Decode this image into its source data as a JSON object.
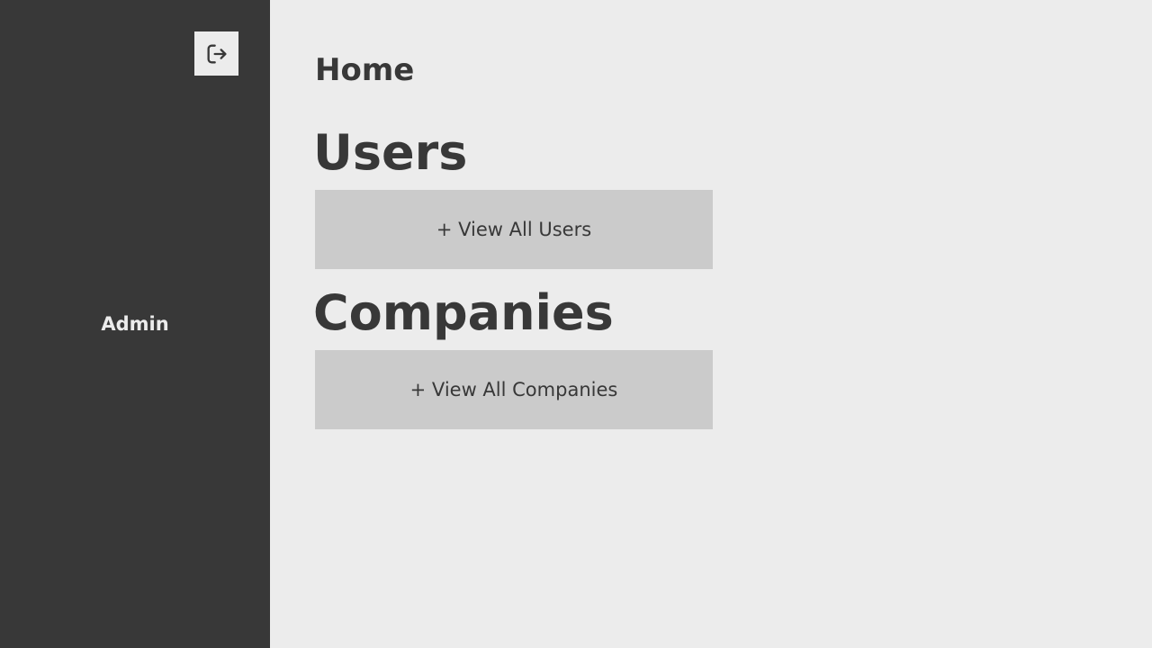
{
  "sidebar": {
    "username": "Admin",
    "logout_icon": "logout-icon"
  },
  "main": {
    "page_title": "Home",
    "sections": [
      {
        "heading": "Users",
        "button_label": "+ View All Users"
      },
      {
        "heading": "Companies",
        "button_label": "+ View All Companies"
      }
    ]
  },
  "colors": {
    "sidebar_bg": "#383838",
    "main_bg": "#ececec",
    "button_bg": "#cbcbcb",
    "text": "#383838"
  }
}
